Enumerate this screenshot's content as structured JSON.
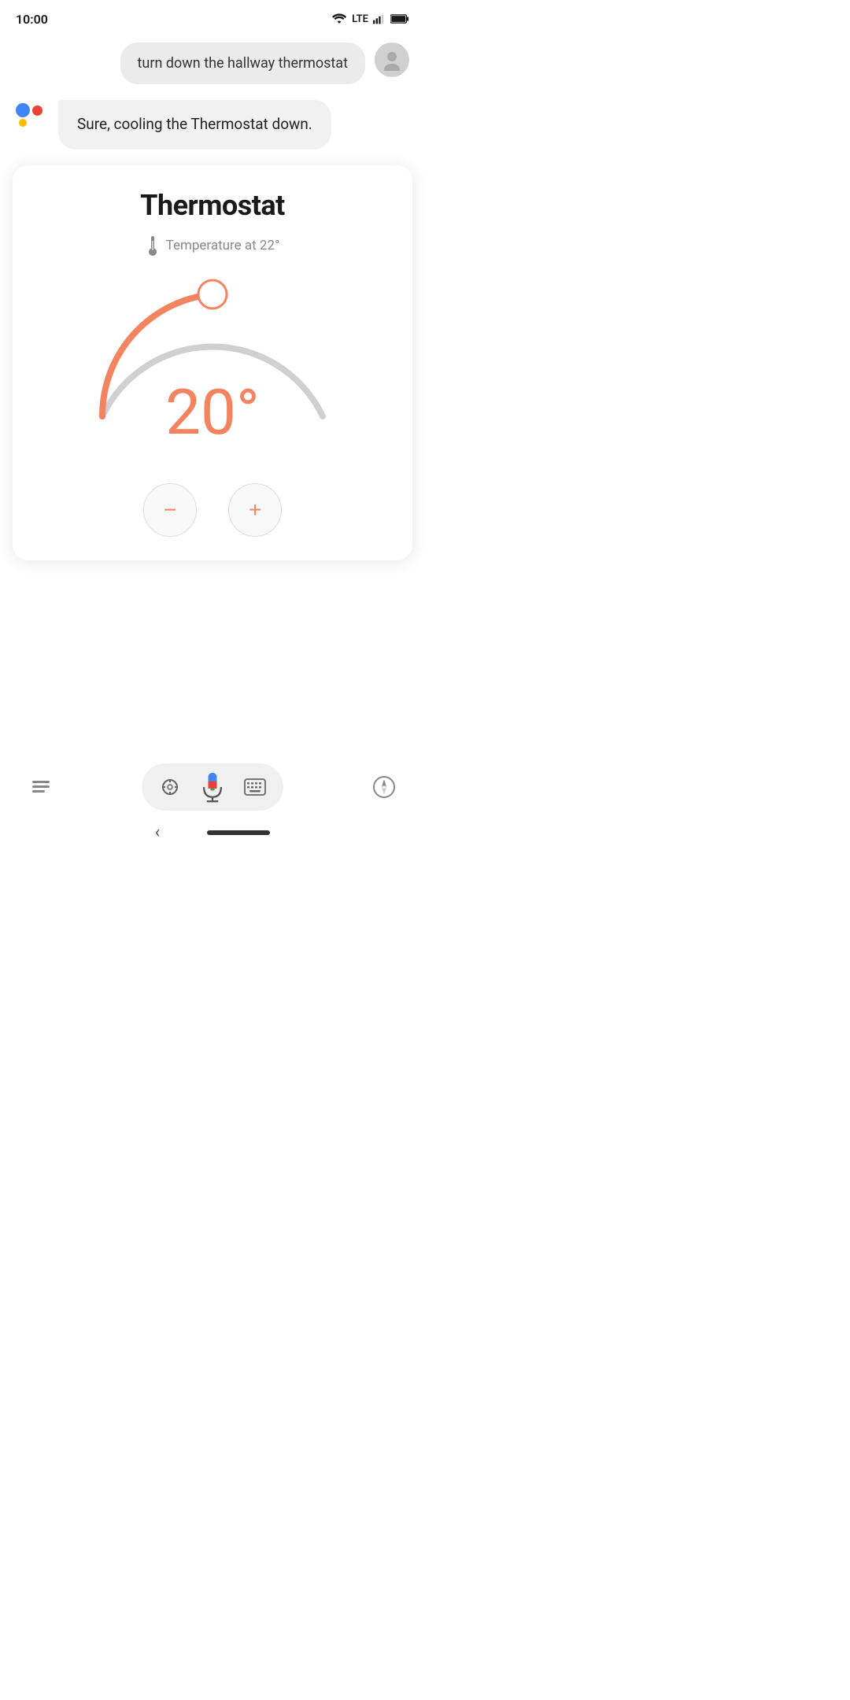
{
  "statusBar": {
    "time": "10:00",
    "lte": "LTE"
  },
  "userMessage": {
    "text": "turn down the hallway thermostat"
  },
  "assistantMessage": {
    "text": "Sure, cooling the Thermostat down."
  },
  "thermostat": {
    "title": "Thermostat",
    "tempLabel": "Temperature at 22°",
    "currentTemp": "20°",
    "accentColor": "#F4845F",
    "arcColor": "#F4845F",
    "arcTrackColor": "#d0d0d0"
  },
  "controls": {
    "decreaseLabel": "−",
    "increaseLabel": "+"
  },
  "bottomNav": {
    "assistantLabel": "assistant",
    "lensLabel": "lens",
    "micLabel": "mic",
    "keyboardLabel": "keyboard",
    "compassLabel": "compass"
  }
}
